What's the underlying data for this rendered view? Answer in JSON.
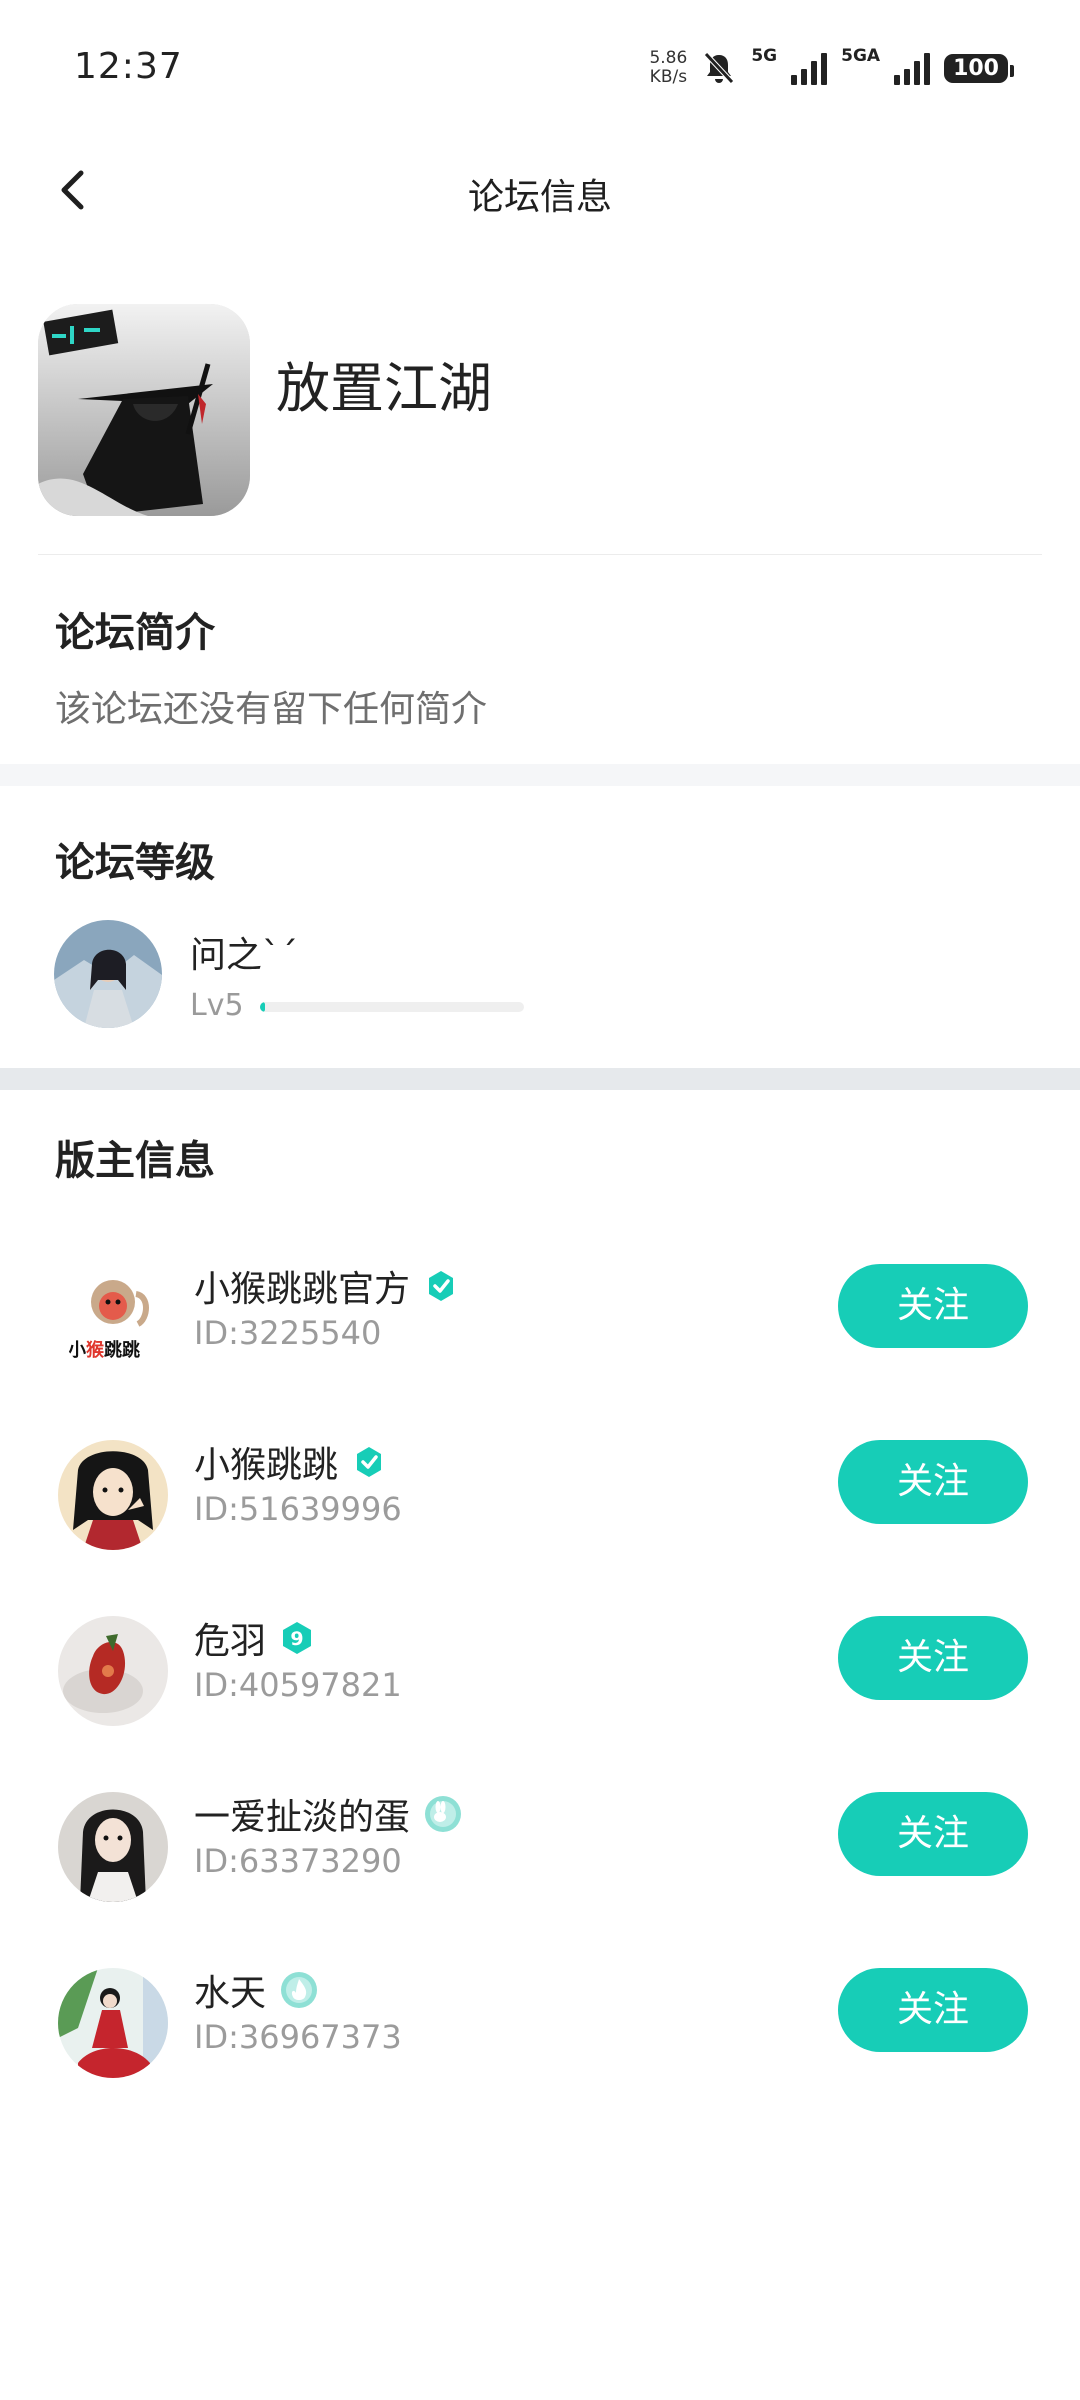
{
  "status_bar": {
    "time": "12:37",
    "net_speed_value": "5.86",
    "net_speed_unit": "KB/s",
    "sim1_label": "5G",
    "sim2_label": "5GA",
    "battery": "100"
  },
  "header": {
    "title": "论坛信息",
    "back_icon": "chevron-left-icon"
  },
  "forum": {
    "name": "放置江湖"
  },
  "intro": {
    "title": "论坛简介",
    "text": "该论坛还没有留下任何简介"
  },
  "level": {
    "title": "论坛等级",
    "user_name": "问之ˋˊ",
    "level_label": "Lv5",
    "progress_percent": 2
  },
  "moderators": {
    "title": "版主信息",
    "follow_label": "关注",
    "items": [
      {
        "name": "小猴跳跳官方",
        "id": "ID:3225540",
        "badge": "verified-check-icon"
      },
      {
        "name": "小猴跳跳",
        "id": "ID:51639996",
        "badge": "verified-check-icon"
      },
      {
        "name": "危羽",
        "id": "ID:40597821",
        "badge": "level-9-badge-icon"
      },
      {
        "name": "一爱扯淡的蛋",
        "id": "ID:63373290",
        "badge": "rabbit-badge-icon"
      },
      {
        "name": "水天",
        "id": "ID:36967373",
        "badge": "flame-badge-icon"
      }
    ]
  },
  "colors": {
    "accent": "#17cdb7",
    "section_gap": "#f5f6f8",
    "section_gap_dark": "#e6e9ec"
  }
}
